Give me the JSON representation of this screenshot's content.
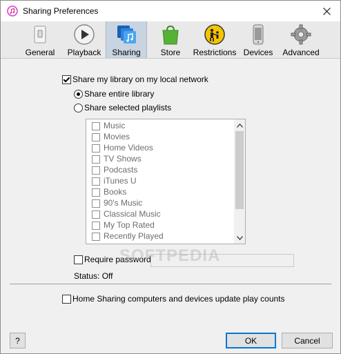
{
  "window": {
    "title": "Sharing Preferences"
  },
  "toolbar": {
    "tabs": [
      {
        "label": "General",
        "icon": "general-icon",
        "active": false
      },
      {
        "label": "Playback",
        "icon": "playback-icon",
        "active": false
      },
      {
        "label": "Sharing",
        "icon": "sharing-icon",
        "active": true
      },
      {
        "label": "Store",
        "icon": "store-icon",
        "active": false
      },
      {
        "label": "Restrictions",
        "icon": "restrictions-icon",
        "active": false
      },
      {
        "label": "Devices",
        "icon": "devices-icon",
        "active": false
      },
      {
        "label": "Advanced",
        "icon": "advanced-icon",
        "active": false
      }
    ]
  },
  "sharing": {
    "share_library_label": "Share my library on my local network",
    "share_library_checked": true,
    "share_entire_label": "Share entire library",
    "share_selected_label": "Share selected playlists",
    "share_mode": "entire",
    "playlists": [
      "Music",
      "Movies",
      "Home Videos",
      "TV Shows",
      "Podcasts",
      "iTunes U",
      "Books",
      "90's Music",
      "Classical Music",
      "My Top Rated",
      "Recently Played"
    ],
    "require_password_label": "Require password:",
    "require_password_checked": false,
    "password_value": "",
    "status_text": "Status: Off"
  },
  "home_sharing": {
    "label": "Home Sharing computers and devices update play counts",
    "checked": false
  },
  "footer": {
    "help_label": "?",
    "ok_label": "OK",
    "cancel_label": "Cancel"
  },
  "watermark": "SOFTPEDIA"
}
